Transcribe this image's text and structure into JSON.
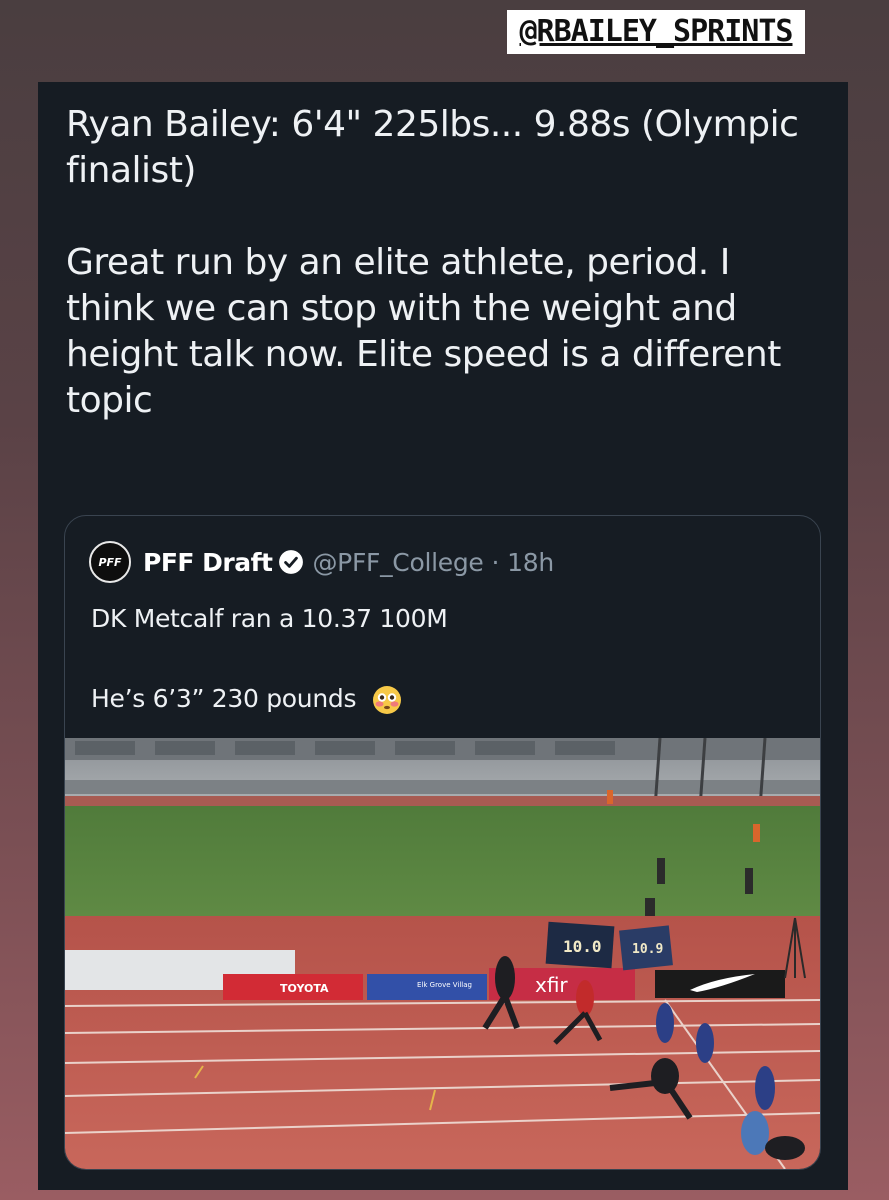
{
  "story": {
    "handle_tag": "@RBAILEY_SPRINTS"
  },
  "tweet": {
    "paragraphs": [
      "Ryan Bailey: 6'4\" 225lbs... 9.88s (Olympic finalist)",
      "Great run by an elite athlete, period. I think we can stop with the weight and height talk now. Elite speed is a different topic"
    ]
  },
  "quoted_tweet": {
    "avatar_text": "PFF",
    "display_name": "PFF Draft",
    "verified_icon": "verified-badge-icon",
    "handle": "@PFF_College",
    "separator": "·",
    "time": "18h",
    "lines": [
      "DK Metcalf ran a 10.37 100M",
      "He’s 6’3” 230 pounds"
    ],
    "emoji_icon": "flushed-face-emoji",
    "media": {
      "description_icon": "race-photo",
      "sponsor_toyota": "TOYOTA",
      "sponsor_elk": "Elk Grove Villag",
      "sponsor_xfin": "xfir",
      "clock_left": "10.0",
      "clock_right": "10.9"
    }
  },
  "colors": {
    "card_bg": "#161c23",
    "text": "#eef1f4",
    "muted": "#8b98a5",
    "verified": "#ffffff"
  }
}
